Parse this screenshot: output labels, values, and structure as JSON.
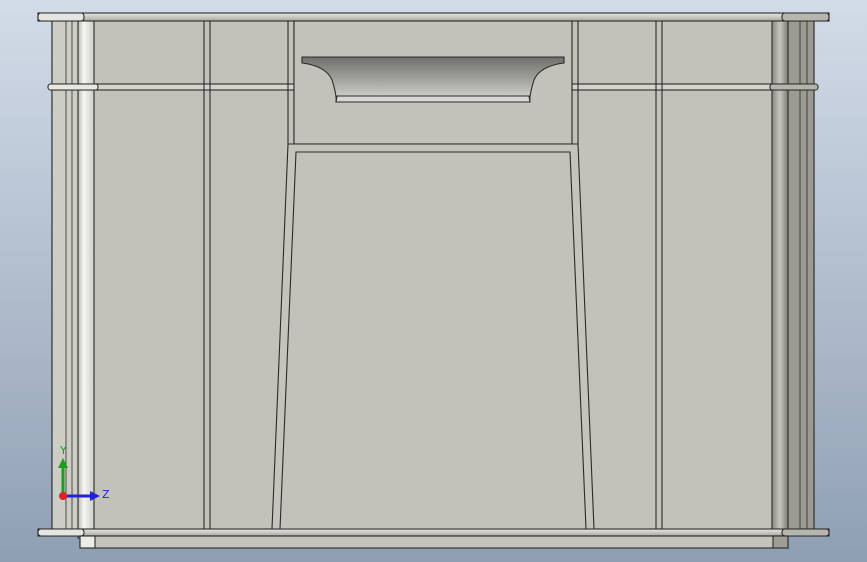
{
  "viewport": {
    "background_top": "#d2dce8",
    "background_bottom": "#8f9fb3"
  },
  "model": {
    "body_color": "#c2c2ba",
    "edge_color": "#2a2a2a",
    "highlight_color": "#f4f4f0",
    "shadow_color": "#7a7a72",
    "handle_dark": "#7e7f78",
    "handle_light": "#d8d8d2"
  },
  "triad": {
    "y_label": "Y",
    "z_label": "Z",
    "y_color": "#1aa01a",
    "z_color": "#2222dd",
    "x_color": "#dd2222"
  }
}
